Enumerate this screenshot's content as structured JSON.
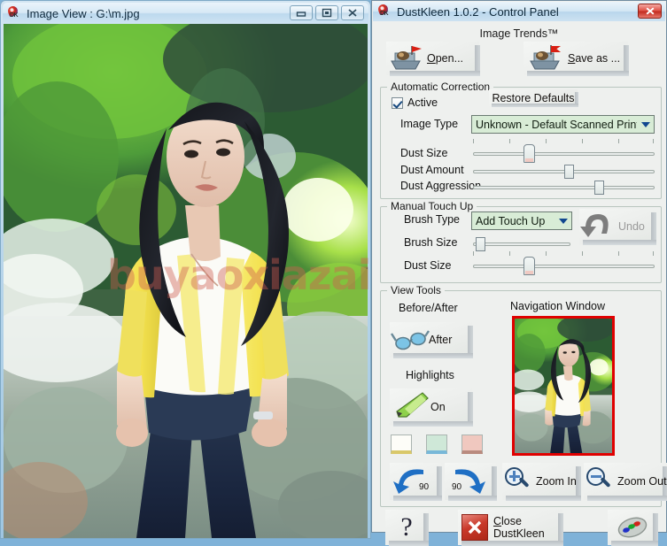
{
  "desktop": {
    "background": "#7fb2d8"
  },
  "image_window": {
    "title": "Image View : G:\\m.jpg",
    "app_icon": "dustkleen-icon",
    "buttons": {
      "minimize": "minimize-icon",
      "maximize": "restore-icon",
      "close": "close-icon"
    }
  },
  "watermark": {
    "text": "buyaoxiazai",
    "color": "#ce5c50"
  },
  "control_panel": {
    "title": "DustKleen 1.0.2 - Control Panel",
    "close_label": "x",
    "brand": "Image Trends™",
    "file_buttons": [
      {
        "label": "Open...",
        "underline": "O",
        "icon": "open-folder-boat-icon"
      },
      {
        "label": "Save as ...",
        "underline": "S",
        "icon": "save-boat-icon"
      }
    ],
    "automatic_correction": {
      "title": "Automatic Correction",
      "active_label": "Active",
      "active_checked": true,
      "restore_defaults_label": "Restore Defaults",
      "image_type_label": "Image Type",
      "image_type_value": "Unknown - Default Scanned Print (B&",
      "sliders": [
        {
          "label": "Dust Size",
          "percent": 28,
          "style": "pointy",
          "ticks": 6
        },
        {
          "label": "Dust Amount",
          "percent": 50,
          "style": "flat",
          "ticks": 0
        },
        {
          "label": "Dust Aggression",
          "percent": 67,
          "style": "flat",
          "ticks": 0
        }
      ]
    },
    "manual_touch_up": {
      "title": "Manual Touch Up",
      "brush_type_label": "Brush Type",
      "brush_type_value": "Add Touch Up",
      "undo_label": "Undo",
      "undo_icon": "undo-arrow-icon",
      "sliders": [
        {
          "label": "Brush Size",
          "percent": 5,
          "style": "flat",
          "ticks": 0
        },
        {
          "label": "Dust Size",
          "percent": 28,
          "style": "pointy",
          "ticks": 6
        }
      ]
    },
    "view_tools": {
      "title": "View Tools",
      "before_after_label": "Before/After",
      "before_after_button": "After",
      "before_after_icon": "glasses-icon",
      "highlights_label": "Highlights",
      "highlights_button": "On",
      "highlights_icon": "marker-pen-icon",
      "swatches": [
        {
          "name": "swatch-white",
          "color": "#fdfdf8"
        },
        {
          "name": "swatch-green",
          "color": "#cfe8d8"
        },
        {
          "name": "swatch-pink",
          "color": "#f0c8bf"
        }
      ],
      "navigation_window_label": "Navigation Window",
      "nav_border_color": "#e00000",
      "rotate_left_label": "90",
      "rotate_right_label": "90",
      "rotate_left_icon": "rotate-left-icon",
      "rotate_right_icon": "rotate-right-icon",
      "zoom_in_label": "Zoom In",
      "zoom_in_icon": "magnifier-plus-icon",
      "zoom_out_label": "Zoom Out",
      "zoom_out_icon": "magnifier-minus-icon"
    },
    "footer": {
      "help_label": "?",
      "help_icon": "question-mark-icon",
      "close_app_label": "Close DustKleen",
      "close_app_underline": "C",
      "close_app_icon": "red-x-icon",
      "palette_icon": "color-palette-icon"
    }
  }
}
